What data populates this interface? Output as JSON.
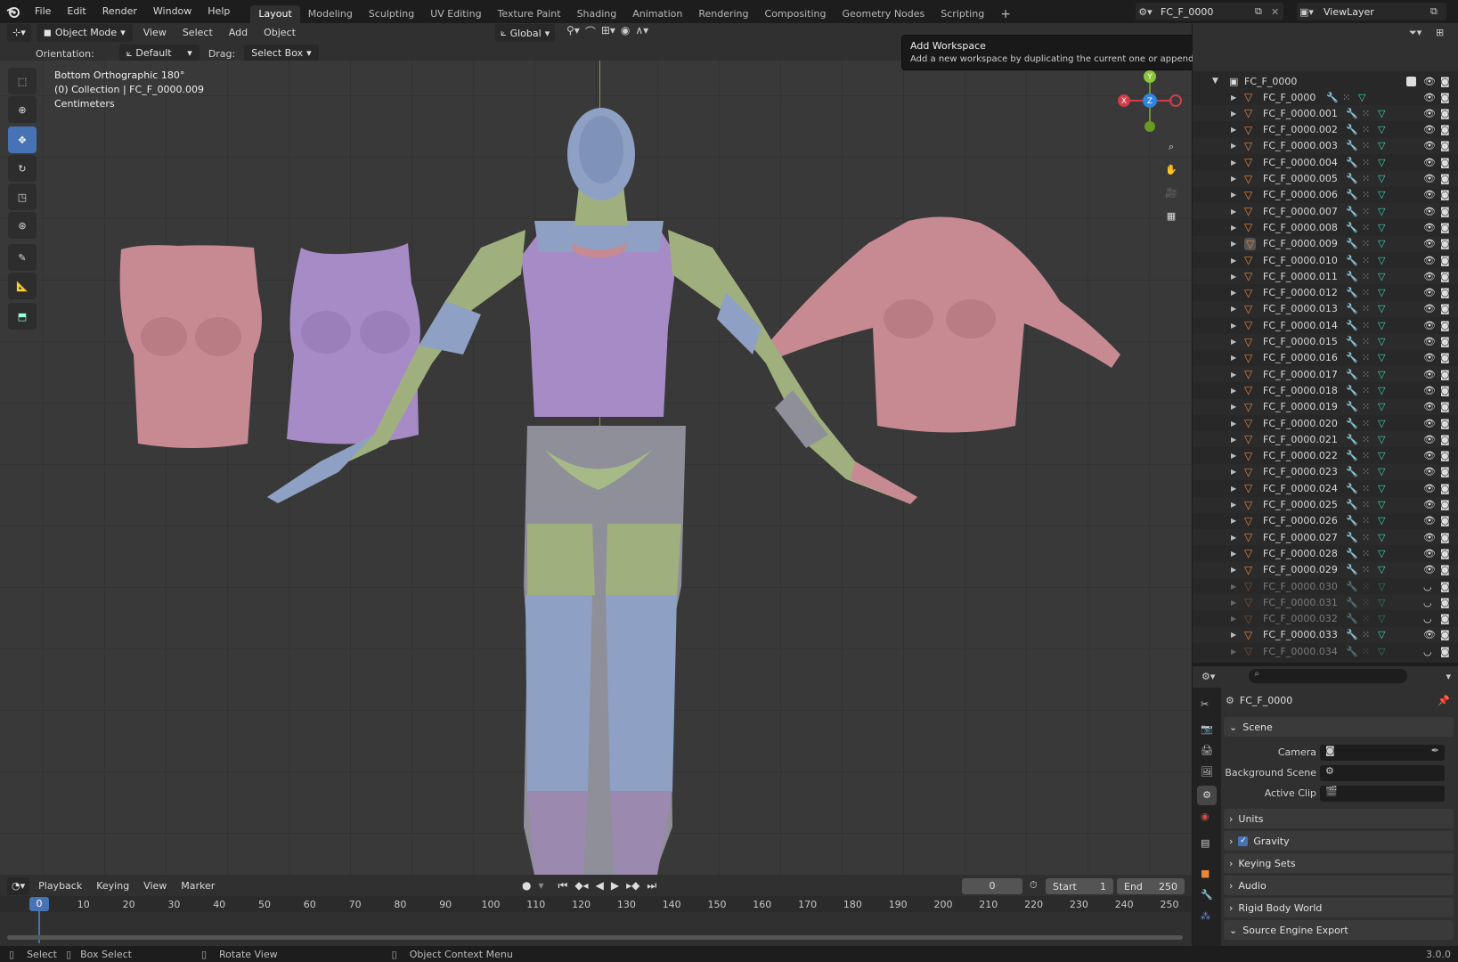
{
  "app": {
    "version": "3.0.0"
  },
  "menus": [
    "File",
    "Edit",
    "Render",
    "Window",
    "Help"
  ],
  "workspaces": {
    "tabs": [
      "Layout",
      "Modeling",
      "Sculpting",
      "UV Editing",
      "Texture Paint",
      "Shading",
      "Animation",
      "Rendering",
      "Compositing",
      "Geometry Nodes",
      "Scripting"
    ],
    "active": "Layout",
    "add_symbol": "+"
  },
  "scene_selector": {
    "value": "FC_F_0000"
  },
  "viewlayer_selector": {
    "value": "ViewLayer"
  },
  "tooltip": {
    "title": "Add Workspace",
    "body": "Add a new workspace by duplicating the current one or appending one from the user configuration."
  },
  "viewport_header": {
    "mode": "Object Mode",
    "menus": [
      "View",
      "Select",
      "Add",
      "Object"
    ],
    "transform_orientation": "Global"
  },
  "tool_settings": {
    "orientation_label": "Orientation:",
    "orientation_value": "Default",
    "drag_label": "Drag:",
    "drag_value": "Select Box"
  },
  "viewport_overlay": {
    "view_name": "Bottom Orthographic 180°",
    "collection": "(0) Collection | FC_F_0000.009",
    "units": "Centimeters"
  },
  "gizmo": {
    "x": "X",
    "y": "Y",
    "z": "Z"
  },
  "colors": {
    "accent": "#4772b3",
    "axis_x": "#d03d4a",
    "axis_y": "#6a9a23",
    "axis_z": "#2f86e0",
    "mesh_orange": "#e9873a",
    "modifier_blue": "#6e8fd8",
    "data_green": "#3dd6b6",
    "body_pink": "#c78a92",
    "body_purple": "#a68bc6",
    "body_green": "#9fb07e",
    "body_blue": "#8ea0c4"
  },
  "outliner": {
    "root": "FC_F_0000",
    "items": [
      {
        "name": "FC_F_0000",
        "visible": true
      },
      {
        "name": "FC_F_0000.001",
        "visible": true
      },
      {
        "name": "FC_F_0000.002",
        "visible": true
      },
      {
        "name": "FC_F_0000.003",
        "visible": true
      },
      {
        "name": "FC_F_0000.004",
        "visible": true
      },
      {
        "name": "FC_F_0000.005",
        "visible": true
      },
      {
        "name": "FC_F_0000.006",
        "visible": true
      },
      {
        "name": "FC_F_0000.007",
        "visible": true
      },
      {
        "name": "FC_F_0000.008",
        "visible": true
      },
      {
        "name": "FC_F_0000.009",
        "visible": true,
        "active": true
      },
      {
        "name": "FC_F_0000.010",
        "visible": true
      },
      {
        "name": "FC_F_0000.011",
        "visible": true
      },
      {
        "name": "FC_F_0000.012",
        "visible": true
      },
      {
        "name": "FC_F_0000.013",
        "visible": true
      },
      {
        "name": "FC_F_0000.014",
        "visible": true
      },
      {
        "name": "FC_F_0000.015",
        "visible": true
      },
      {
        "name": "FC_F_0000.016",
        "visible": true
      },
      {
        "name": "FC_F_0000.017",
        "visible": true
      },
      {
        "name": "FC_F_0000.018",
        "visible": true
      },
      {
        "name": "FC_F_0000.019",
        "visible": true
      },
      {
        "name": "FC_F_0000.020",
        "visible": true
      },
      {
        "name": "FC_F_0000.021",
        "visible": true
      },
      {
        "name": "FC_F_0000.022",
        "visible": true
      },
      {
        "name": "FC_F_0000.023",
        "visible": true
      },
      {
        "name": "FC_F_0000.024",
        "visible": true
      },
      {
        "name": "FC_F_0000.025",
        "visible": true
      },
      {
        "name": "FC_F_0000.026",
        "visible": true
      },
      {
        "name": "FC_F_0000.027",
        "visible": true
      },
      {
        "name": "FC_F_0000.028",
        "visible": true
      },
      {
        "name": "FC_F_0000.029",
        "visible": true
      },
      {
        "name": "FC_F_0000.030",
        "visible": false
      },
      {
        "name": "FC_F_0000.031",
        "visible": false
      },
      {
        "name": "FC_F_0000.032",
        "visible": false
      },
      {
        "name": "FC_F_0000.033",
        "visible": true
      },
      {
        "name": "FC_F_0000.034",
        "visible": false
      }
    ]
  },
  "properties": {
    "context": "FC_F_0000",
    "scene_panel": "Scene",
    "camera_label": "Camera",
    "background_scene_label": "Background Scene",
    "active_clip_label": "Active Clip",
    "panels": [
      "Units",
      "Gravity",
      "Keying Sets",
      "Audio",
      "Rigid Body World",
      "Source Engine Export"
    ],
    "gravity_checked": true
  },
  "timeline": {
    "menus": [
      "Playback",
      "Keying",
      "View",
      "Marker"
    ],
    "current_frame": "0",
    "start_label": "Start",
    "start_value": "1",
    "end_label": "End",
    "end_value": "250",
    "ticks": [
      "0",
      "10",
      "20",
      "30",
      "40",
      "50",
      "60",
      "70",
      "80",
      "90",
      "100",
      "110",
      "120",
      "130",
      "140",
      "150",
      "160",
      "170",
      "180",
      "190",
      "200",
      "210",
      "220",
      "230",
      "240",
      "250"
    ]
  },
  "statusbar": {
    "select": "Select",
    "box_select": "Box Select",
    "rotate_view": "Rotate View",
    "context_menu": "Object Context Menu"
  }
}
